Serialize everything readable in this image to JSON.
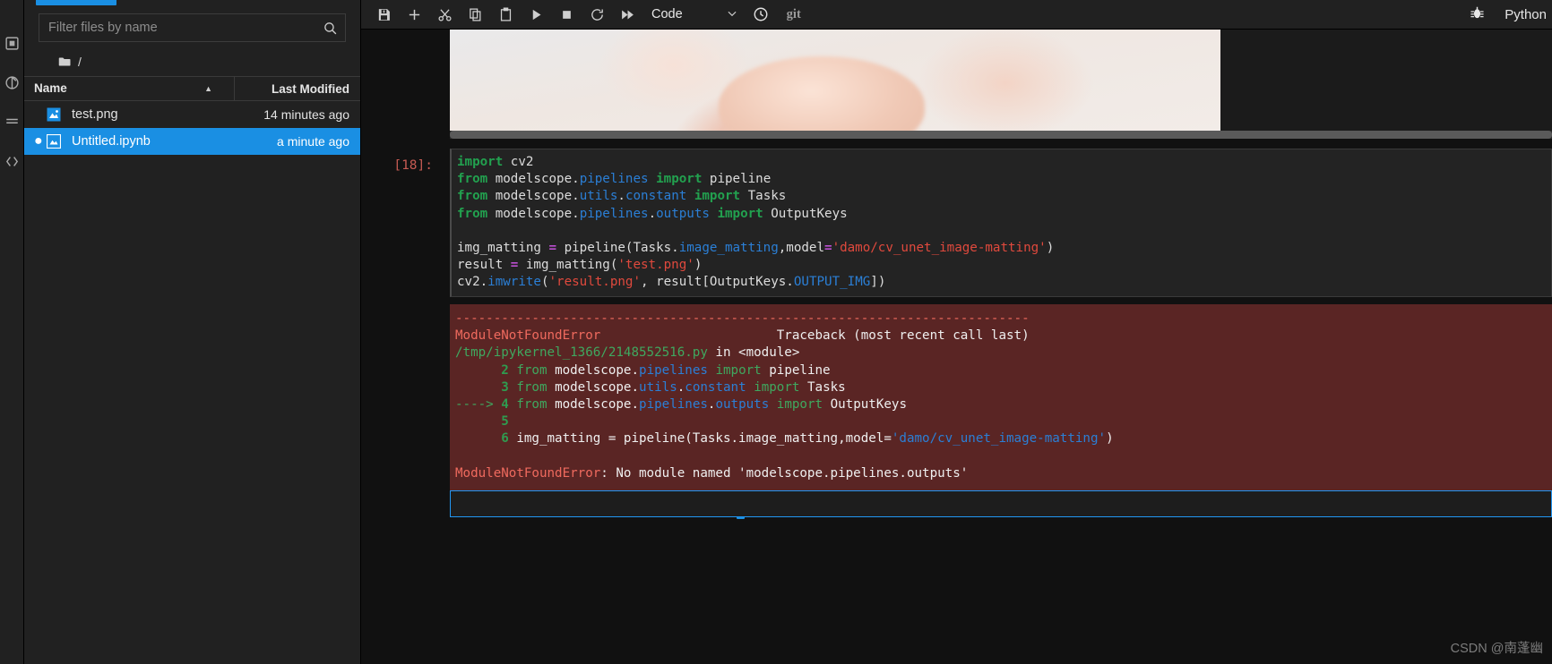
{
  "activity_bar": {
    "icons": [
      "folder-icon",
      "running-terminals-icon",
      "commands-icon",
      "property-inspector-icon",
      "extension-manager-icon"
    ]
  },
  "file_browser": {
    "filter": {
      "placeholder": "Filter files by name",
      "value": ""
    },
    "search_icon": "search-icon",
    "breadcrumb": {
      "folder_icon": "folder-icon",
      "path": "/"
    },
    "columns": {
      "name": "Name",
      "last_modified": "Last Modified",
      "sort_arrow": "▲"
    },
    "rows": [
      {
        "name": "test.png",
        "modified": "14 minutes ago",
        "icon": "image-file-icon",
        "selected": false,
        "dirty": false
      },
      {
        "name": "Untitled.ipynb",
        "modified": "a minute ago",
        "icon": "notebook-file-icon",
        "selected": true,
        "dirty": true
      }
    ]
  },
  "toolbar": {
    "buttons": [
      {
        "name": "save-button",
        "icon": "save-icon",
        "title": "Save"
      },
      {
        "name": "insert-cell-button",
        "icon": "plus-icon",
        "title": "Insert a cell below"
      },
      {
        "name": "cut-button",
        "icon": "scissors-icon",
        "title": "Cut cells"
      },
      {
        "name": "copy-button",
        "icon": "copy-icon",
        "title": "Copy cells"
      },
      {
        "name": "paste-button",
        "icon": "clipboard-icon",
        "title": "Paste cells"
      },
      {
        "name": "run-button",
        "icon": "play-icon",
        "title": "Run"
      },
      {
        "name": "stop-button",
        "icon": "stop-square-icon",
        "title": "Interrupt kernel"
      },
      {
        "name": "restart-button",
        "icon": "restart-circle-icon",
        "title": "Restart kernel"
      },
      {
        "name": "restart-run-all-button",
        "icon": "fast-forward-icon",
        "title": "Restart and run all"
      }
    ],
    "cell_type": {
      "value": "Code",
      "chevron": "chevron-down-icon"
    },
    "clock_icon": "clock-icon",
    "git_label": "git",
    "debugger_icon": "bug-icon",
    "kernel_name": "Python"
  },
  "notebook": {
    "image_output": {
      "alt": "matting-result-image"
    },
    "cells": [
      {
        "prompt": "[18]:",
        "source_lines": [
          [
            {
              "t": "import ",
              "c": "k"
            },
            {
              "t": "cv2",
              "c": "pl"
            }
          ],
          [
            {
              "t": "from ",
              "c": "k"
            },
            {
              "t": "modelscope",
              "c": "pl"
            },
            {
              "t": ".",
              "c": "pl"
            },
            {
              "t": "pipelines",
              "c": "mod"
            },
            {
              "t": " ",
              "c": "pl"
            },
            {
              "t": "import ",
              "c": "k"
            },
            {
              "t": "pipeline",
              "c": "pl"
            }
          ],
          [
            {
              "t": "from ",
              "c": "k"
            },
            {
              "t": "modelscope",
              "c": "pl"
            },
            {
              "t": ".",
              "c": "pl"
            },
            {
              "t": "utils",
              "c": "mod"
            },
            {
              "t": ".",
              "c": "pl"
            },
            {
              "t": "constant",
              "c": "mod"
            },
            {
              "t": " ",
              "c": "pl"
            },
            {
              "t": "import ",
              "c": "k"
            },
            {
              "t": "Tasks",
              "c": "pl"
            }
          ],
          [
            {
              "t": "from ",
              "c": "k"
            },
            {
              "t": "modelscope",
              "c": "pl"
            },
            {
              "t": ".",
              "c": "pl"
            },
            {
              "t": "pipelines",
              "c": "mod"
            },
            {
              "t": ".",
              "c": "pl"
            },
            {
              "t": "outputs",
              "c": "mod"
            },
            {
              "t": " ",
              "c": "pl"
            },
            {
              "t": "import ",
              "c": "k"
            },
            {
              "t": "OutputKeys",
              "c": "pl"
            }
          ],
          [
            {
              "t": "",
              "c": "pl"
            }
          ],
          [
            {
              "t": "img_matting ",
              "c": "pl"
            },
            {
              "t": "=",
              "c": "op"
            },
            {
              "t": " pipeline(Tasks.",
              "c": "pl"
            },
            {
              "t": "image_matting",
              "c": "fn"
            },
            {
              "t": ",model",
              "c": "pl"
            },
            {
              "t": "=",
              "c": "op"
            },
            {
              "t": "'damo/cv_unet_image-matting'",
              "c": "str"
            },
            {
              "t": ")",
              "c": "pl"
            }
          ],
          [
            {
              "t": "result ",
              "c": "pl"
            },
            {
              "t": "=",
              "c": "op"
            },
            {
              "t": " img_matting(",
              "c": "pl"
            },
            {
              "t": "'test.png'",
              "c": "str"
            },
            {
              "t": ")",
              "c": "pl"
            }
          ],
          [
            {
              "t": "cv2.",
              "c": "pl"
            },
            {
              "t": "imwrite",
              "c": "fn"
            },
            {
              "t": "(",
              "c": "pl"
            },
            {
              "t": "'result.png'",
              "c": "str"
            },
            {
              "t": ", result[OutputKeys.",
              "c": "pl"
            },
            {
              "t": "OUTPUT_IMG",
              "c": "fn"
            },
            {
              "t": "])",
              "c": "pl"
            }
          ]
        ],
        "error_lines": [
          [
            {
              "t": "---------------------------------------------------------------------------",
              "c": "e-red"
            }
          ],
          [
            {
              "t": "ModuleNotFoundError",
              "c": "e-red"
            },
            {
              "t": "                       Traceback (most recent call last)",
              "c": "e-white"
            }
          ],
          [
            {
              "t": "/tmp/ipykernel_1366/2148552516.py",
              "c": "e-green"
            },
            {
              "t": " in ",
              "c": "e-white"
            },
            {
              "t": "<module>",
              "c": "e-white"
            }
          ],
          [
            {
              "t": "      2 ",
              "c": "e-green2"
            },
            {
              "t": "from ",
              "c": "e-green"
            },
            {
              "t": "modelscope",
              "c": "e-white"
            },
            {
              "t": ".",
              "c": "e-white"
            },
            {
              "t": "pipelines",
              "c": "e-blue"
            },
            {
              "t": " ",
              "c": "e-white"
            },
            {
              "t": "import ",
              "c": "e-green"
            },
            {
              "t": "pipeline",
              "c": "e-white"
            }
          ],
          [
            {
              "t": "      3 ",
              "c": "e-green2"
            },
            {
              "t": "from ",
              "c": "e-green"
            },
            {
              "t": "modelscope",
              "c": "e-white"
            },
            {
              "t": ".",
              "c": "e-white"
            },
            {
              "t": "utils",
              "c": "e-blue"
            },
            {
              "t": ".",
              "c": "e-white"
            },
            {
              "t": "constant",
              "c": "e-blue"
            },
            {
              "t": " ",
              "c": "e-white"
            },
            {
              "t": "import ",
              "c": "e-green"
            },
            {
              "t": "Tasks",
              "c": "e-white"
            }
          ],
          [
            {
              "t": "----> ",
              "c": "e-arrow"
            },
            {
              "t": "4 ",
              "c": "e-green2"
            },
            {
              "t": "from ",
              "c": "e-green"
            },
            {
              "t": "modelscope",
              "c": "e-white"
            },
            {
              "t": ".",
              "c": "e-white"
            },
            {
              "t": "pipelines",
              "c": "e-blue"
            },
            {
              "t": ".",
              "c": "e-white"
            },
            {
              "t": "outputs",
              "c": "e-blue"
            },
            {
              "t": " ",
              "c": "e-white"
            },
            {
              "t": "import ",
              "c": "e-green"
            },
            {
              "t": "OutputKeys",
              "c": "e-white"
            }
          ],
          [
            {
              "t": "      5 ",
              "c": "e-green2"
            }
          ],
          [
            {
              "t": "      6 ",
              "c": "e-green2"
            },
            {
              "t": "img_matting = pipeline(Tasks.image_matting,model=",
              "c": "e-white"
            },
            {
              "t": "'damo/cv_unet_image-matting'",
              "c": "e-blue"
            },
            {
              "t": ")",
              "c": "e-white"
            }
          ],
          [
            {
              "t": "",
              "c": "e-white"
            }
          ],
          [
            {
              "t": "ModuleNotFoundError",
              "c": "e-red"
            },
            {
              "t": ": No module named ",
              "c": "e-white"
            },
            {
              "t": "'modelscope.pipelines.outputs'",
              "c": "e-white"
            }
          ]
        ]
      },
      {
        "prompt": "[ ]:",
        "source_lines": [],
        "active": true
      }
    ]
  },
  "watermark": "CSDN @南蓬幽",
  "colors": {
    "accent": "#1a8fe3",
    "panel_bg": "#212121",
    "editor_bg": "#111111",
    "code_bg": "#232323",
    "error_bg": "#5a2524",
    "error_red": "#ef6a5e",
    "keyword_green": "#22a14f",
    "string_red": "#e0493d",
    "module_blue": "#2b7fd6"
  }
}
